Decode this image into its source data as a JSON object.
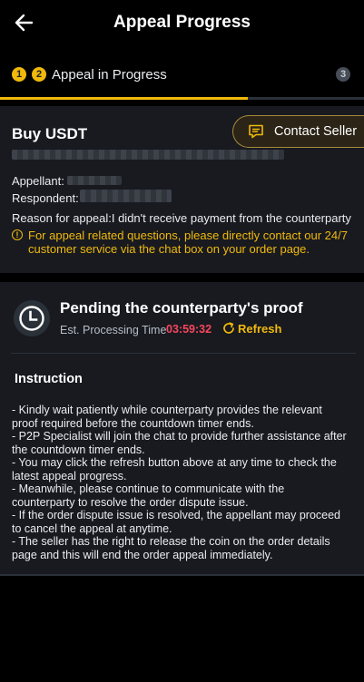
{
  "header": {
    "title": "Appeal Progress",
    "back_icon": "arrow-left-icon"
  },
  "steps": {
    "items": [
      {
        "number": "1",
        "state": "done"
      },
      {
        "number": "2",
        "state": "current"
      },
      {
        "number": "3",
        "state": "upcoming"
      }
    ],
    "current_label": "Appeal in Progress",
    "progress_percent": 68
  },
  "order": {
    "title": "Buy USDT",
    "appellant_label": "Appellant:",
    "respondent_label": "Respondent:",
    "reason_text": "Reason for appeal:I didn't receive payment from the counterparty",
    "notice": "For appeal related questions, please directly contact our 24/7 customer service via the chat box on your order page.",
    "notice_icon": "exclamation-circle-icon"
  },
  "contact_button": {
    "label": "Contact Seller",
    "icon": "chat-icon"
  },
  "status": {
    "title": "Pending the counterparty's proof",
    "est_label": "Est. Processing Time",
    "timer": "03:59:32",
    "refresh_label": "Refresh",
    "icon": "clock-icon"
  },
  "instruction": {
    "title": "Instruction",
    "items": [
      "- Kindly wait patiently while counterparty provides the relevant",
      "proof required before the countdown timer ends.",
      "- P2P Specialist will join the chat to provide further assistance after",
      "the countdown timer ends.",
      "- You may click the refresh button above at any time to check the",
      "latest appeal progress.",
      "- Meanwhile, please continue to communicate with the",
      "counterparty to resolve the order dispute issue.",
      "- If the order dispute issue is resolved, the appellant may proceed",
      "to cancel the appeal at anytime.",
      "- The seller has the right to release the coin on the order details",
      "page and this will end the order appeal immediately."
    ]
  },
  "colors": {
    "accent": "#f0b90b",
    "timer": "#f6465d",
    "card": "#181a20",
    "background": "#000000"
  }
}
